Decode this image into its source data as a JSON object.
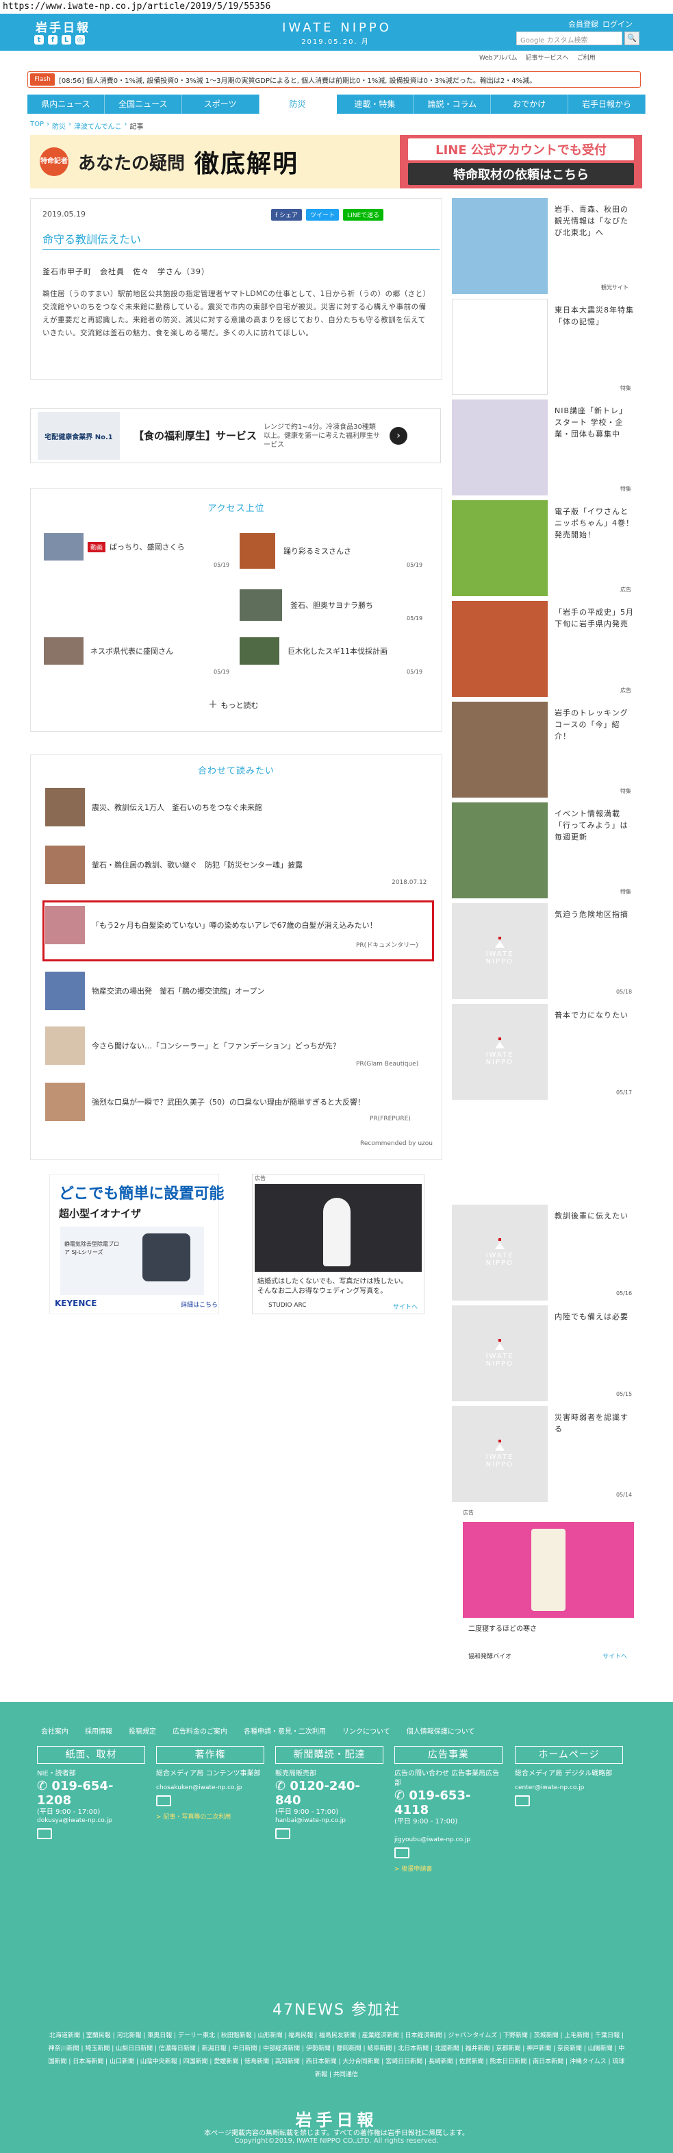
{
  "url": "https://www.iwate-np.co.jp/article/2019/5/19/55356",
  "header": {
    "logo": "岩手日報",
    "brand": "IWATE NIPPO",
    "date": "2019.05.20. 月",
    "member_register": "会員登録",
    "login": "ログイン",
    "search_placeholder": "Google カスタム検索",
    "search_btn": "🔍",
    "subnav": [
      "Webアルバム",
      "記事サービスへ",
      "ご利用"
    ]
  },
  "flash": {
    "tag": "Flash",
    "text": "[08:56] 個人消費0・1%減, 設備投資0・3%減   1～3月期の実質GDPによると, 個人消費は前期比0・1%減, 設備投資は0・3%減だった。輸出は2・4%減。"
  },
  "nav": [
    "県内ニュース",
    "全国ニュース",
    "スポーツ",
    "防災",
    "連載・特集",
    "論説・コラム",
    "おでかけ",
    "岩手日報から"
  ],
  "breadcrumbs": [
    "TOP",
    "防災",
    "津波てんでんこ",
    "記事"
  ],
  "banner": {
    "badge": "特命記者",
    "title": "あなたの疑問",
    "title2": "徹底解明",
    "line1": "LINE 公式アカウントでも受付",
    "line2": "特命取材の依頼はこちら"
  },
  "article": {
    "date": "2019.05.19",
    "share": [
      "f シェア",
      "ツイート",
      "LINEで送る"
    ],
    "title": "命守る教訓伝えたい",
    "author": "釜石市甲子町　会社員　佐々　学さん（39）",
    "body": "鵜住居（うのすまい）駅前地区公共施設の指定管理者ヤマトLDMCの仕事として、1日から祈（うの）の郷（さと）交流館やいのちをつなぐ未来館に勤務している。震災で市内の東部や自宅が被災。災害に対する心構えや事前の備えが重要だと再認識した。来館者の防災、減災に対する意識の高まりを感じており、自分たちも守る教訓を伝えていきたい。交流館は釜石の魅力、食を楽しめる場だ。多くの人に訪れてほしい。"
  },
  "ad1": {
    "label": "宅配健康食業界 No.1",
    "title": "【食の福利厚生】サービス",
    "sub": "レンジで約1~4分。冷凍食品30種類以上。健康を第一に考えた福利厚生サービス"
  },
  "ranking": {
    "title": "アクセス上位",
    "items": [
      {
        "badge": "動画",
        "title": "ばっちり、盛岡さくら",
        "date": "05/19"
      },
      {
        "title": "踊り彩るミスさんさ",
        "date": "05/19"
      },
      {
        "title": "釜石、胆奥サヨナラ勝ち",
        "date": "05/19"
      },
      {
        "title": "ネスボ県代表に盛岡さん",
        "date": "05/19"
      },
      {
        "title": "巨木化したスギ11本伐採計画",
        "date": "05/19"
      }
    ],
    "more": "もっと読む"
  },
  "recommend": {
    "title": "合わせて読みたい",
    "items": [
      {
        "title": "震災、教訓伝え1万人　釜石いのちをつなぐ未来館",
        "meta": ""
      },
      {
        "title": "釜石・鵜住居の教訓、歌い継ぐ　防犯「防災センター魂」披露",
        "meta": "2018.07.12"
      },
      {
        "title": "「もう2ヶ月も白髪染めていない」噂の染めないアレで67歳の白髪が消え込みたい！",
        "meta": "PR(ドキュメンタリー)"
      },
      {
        "title": "物産交流の場出発　釜石「鵜の郷交流館」オープン",
        "meta": ""
      },
      {
        "title": "今さら聞けない…「コンシーラー」と「ファンデーション」どっちが先？",
        "meta": "PR(Glam Beautique)"
      },
      {
        "title": "強烈な口臭が一瞬で？武田久美子（50）の口臭ない理由が簡単すぎると大反響！",
        "meta": "PR(FREPURE)"
      }
    ],
    "powered": "Recommended by uzou"
  },
  "ad_keyence": {
    "title": "どこでも簡単に設置可能",
    "sub": "超小型イオナイザ",
    "product": "静電気除去型除電ブロア SJ-Lシリーズ",
    "brand": "KEYENCE",
    "more": "詳細はこちら"
  },
  "ad_wedding": {
    "label": "広告",
    "text": "結婚式はしたくないでも、写真だけは残したい。そんなお二人お得なウェディング写真を。",
    "brand": "STUDIO ARC",
    "more": "サイトへ"
  },
  "sidebar": [
    {
      "title": "岩手、青森、秋田の観光情報は「なびたび北東北」へ",
      "tag": "観光サイト"
    },
    {
      "title": "東日本大震災8年特集「体の記憶」",
      "tag": "特集"
    },
    {
      "title": "NIB講座「新トレ」スタート 学校・企業・団体も募集中",
      "tag": "特集"
    },
    {
      "title": "電子版「イワさんとニッポちゃん」4巻！発売開始！",
      "tag": "広告"
    },
    {
      "title": "「岩手の平成史」5月下旬に岩手県内発売",
      "tag": "広告"
    },
    {
      "title": "岩手のトレッキングコースの「今」紹介！",
      "tag": "特集"
    },
    {
      "title": "イベント情報満載「行ってみよう」は毎週更新",
      "tag": "特集"
    },
    {
      "title": "気迫う危険地区指摘",
      "tag": "05/18"
    },
    {
      "title": "普本で力になりたい",
      "tag": "05/17"
    },
    {
      "title": "教訓後輩に伝えたい",
      "tag": "05/16"
    },
    {
      "title": "内陸でも備えは必要",
      "tag": "05/15"
    },
    {
      "title": "災害時弱者を認識する",
      "tag": "05/14"
    }
  ],
  "side_ad": {
    "label": "広告",
    "text": "二度寝するほどの寒さ",
    "brand": "協和発酵バイオ",
    "more": "サイトへ"
  },
  "footer": {
    "links": [
      "会社案内",
      "採用情報",
      "投稿規定",
      "広告料金のご案内",
      "各種申請・意見・二次利用",
      "リンクについて",
      "個人情報保護について"
    ],
    "cols": [
      {
        "box": "紙面、取材",
        "l1": "NIE・読者部",
        "phone": "019-654-1208",
        "hours": "(平日 9:00 - 17:00)",
        "mail": "dokusya@iwate-np.co.jp",
        "extra": ""
      },
      {
        "box": "著作権",
        "l1": "総合メディア局 コンテンツ事業部",
        "phone": "",
        "hours": "",
        "mail": "chosakuken@iwate-np.co.jp",
        "extra": "> 記事・写真等の二次利用"
      },
      {
        "box": "新聞購読・配達",
        "l1": "販売局販売部",
        "phone": "0120-240-840",
        "hours": "(平日 9:00 - 17:00)",
        "mail": "hanbai@iwate-np.co.jp",
        "extra": ""
      },
      {
        "box": "広告事業",
        "l1": "広告の問い合わせ 広告事業局広告部",
        "phone": "019-653-4118",
        "hours": "(平日 9:00 - 17:00)",
        "mail": "jigyoubu@iwate-np.co.jp",
        "extra": "> 後援申請書"
      },
      {
        "box": "ホームページ",
        "l1": "総合メディア局 デジタル戦略部",
        "phone": "",
        "hours": "",
        "mail": "center@iwate-np.co.jp",
        "extra": ""
      }
    ],
    "news_title": "47NEWS 参加社",
    "news_list": "北海道新聞 | 室蘭民報 | 河北新報 | 東奥日報 | デーリー東北 | 秋田魁新報 | 山形新聞 | 福島民報 | 福島民友新聞 | 産業経済新聞 | 日本経済新聞 | ジャパンタイムズ | 下野新聞 | 茨城新聞 | 上毛新聞 | 千葉日報 | 神奈川新聞 | 埼玉新聞 | 山梨日日新聞 | 信濃毎日新聞 | 新潟日報 | 中日新聞 | 中部経済新聞 | 伊勢新聞 | 静岡新聞 | 岐阜新聞 | 北日本新聞 | 北國新聞 | 福井新聞 | 京都新聞 | 神戸新聞 | 奈良新聞 | 山陽新聞 | 中国新聞 | 日本海新聞 | 山口新聞 | 山陰中央新報 | 四国新聞 | 愛媛新聞 | 徳島新聞 | 高知新聞 | 西日本新聞 | 大分合同新聞 | 宮崎日日新聞 | 長崎新聞 | 佐賀新聞 | 熊本日日新聞 | 南日本新聞 | 沖縄タイムス | 琉球新報 | 共同通信",
    "logo": "岩手日報",
    "note": "本ページ掲載内容の無断転載を禁じます。すべての著作権は岩手日報社に帰属します。",
    "copy": "Copyright©2019, IWATE NIPPO CO.,LTD. All rights reserved."
  }
}
